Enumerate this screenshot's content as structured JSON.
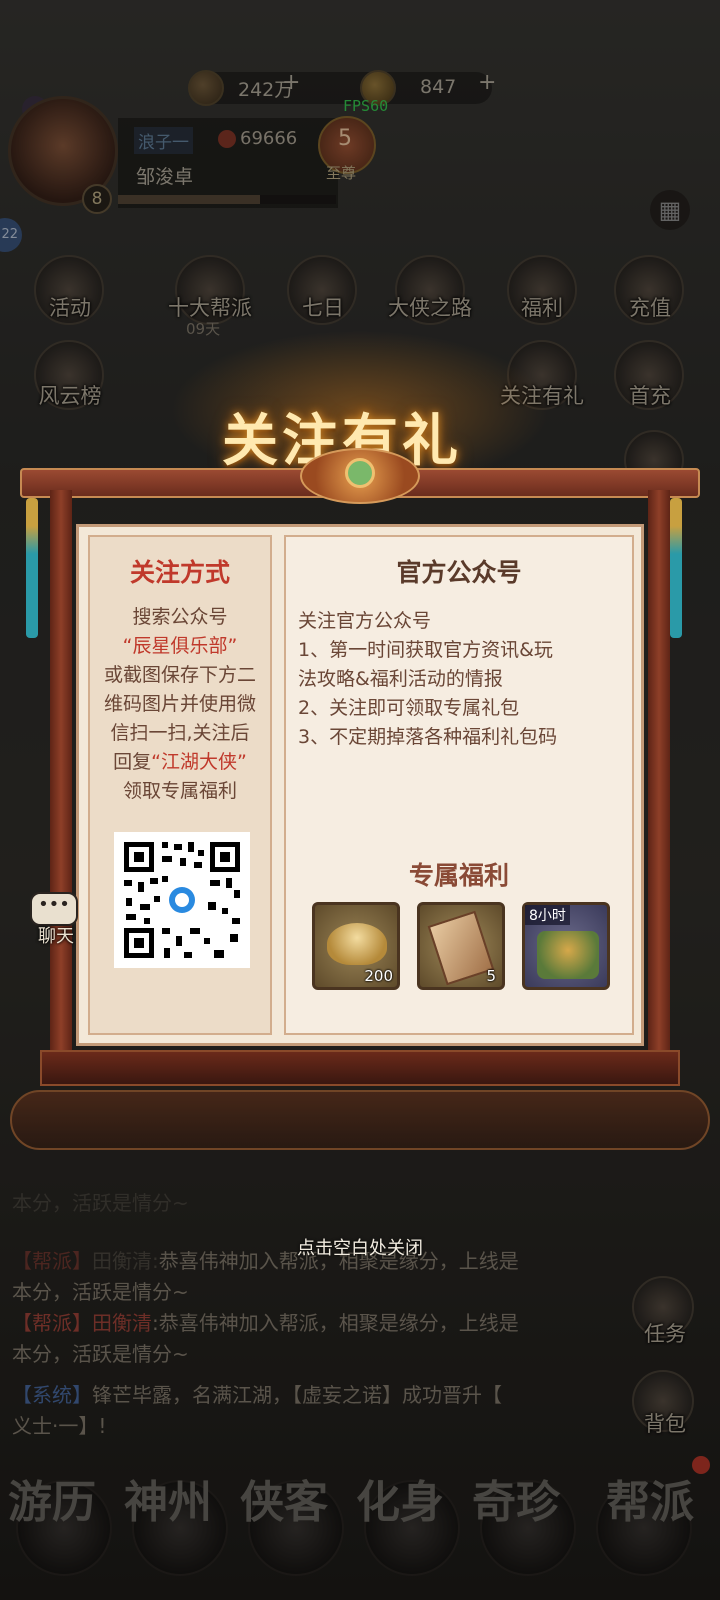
{
  "header": {
    "copper": "242万",
    "gold": "847",
    "plus": "+",
    "fps": "FPS60",
    "player_level": "8",
    "title_tag": "浪子一",
    "combat_power": "69666",
    "vip_level": "5",
    "vip_label": "至尊",
    "player_name": "邹浚卓",
    "side_badge": "22"
  },
  "menu": {
    "row1": [
      {
        "label": "活动"
      },
      {
        "label": "十大帮派",
        "sub": "09天"
      },
      {
        "label": "七日"
      },
      {
        "label": "大侠之路"
      },
      {
        "label": "福利"
      },
      {
        "label": "充值"
      }
    ],
    "row2": [
      {
        "label": "风云榜"
      },
      {
        "label": "关注有礼"
      },
      {
        "label": "首充"
      }
    ]
  },
  "popup": {
    "title": "关注有礼",
    "left": {
      "heading": "关注方式",
      "l1": "搜索公众号",
      "l2": "“辰星俱乐部”",
      "l3": "或截图保存下方二",
      "l4": "维码图片并使用微",
      "l5": "信扫一扫,关注后",
      "l6a": "回复",
      "l6b": "“江湖大侠”",
      "l7": "领取专属福利"
    },
    "right": {
      "heading": "官方公众号",
      "lines": [
        "关注官方公众号",
        "1、第一时间获取官方资讯&玩",
        "法攻略&福利活动的情报",
        "2、关注即可领取专属礼包",
        "3、不定期掉落各种福利礼包码"
      ],
      "rewards_heading": "专属福利",
      "rewards": [
        {
          "icon": "gold-ingot-icon",
          "qty": "200"
        },
        {
          "icon": "xia-token-icon",
          "qty": "5"
        },
        {
          "icon": "treasure-chest-icon",
          "badge": "8小时"
        }
      ]
    },
    "close_hint": "点击空白处关闭"
  },
  "chat": {
    "side_label": "聊天",
    "lines": [
      {
        "tag": "【帮派】",
        "name": "田衡清",
        "text": "恭喜伟神加入帮派，相聚是缘分，上线是",
        "cont": "本分，活跃是情分~"
      },
      {
        "tag": "【系统】",
        "name": "",
        "text": "锋芒毕露，名满江湖，【虚妄之诺】成功晋升【",
        "cont": "义士·一】!"
      }
    ],
    "faded_line": "恭喜伟神加入帮派，相聚是缘分，上线是",
    "faded_cont": "本分，活跃是情分~"
  },
  "side_buttons": {
    "task": "任务",
    "bag": "背包"
  },
  "bottom_nav": [
    {
      "label": "游历"
    },
    {
      "label": "神州"
    },
    {
      "label": "侠客"
    },
    {
      "label": "化身"
    },
    {
      "label": "奇珍"
    },
    {
      "label": "帮派"
    }
  ]
}
